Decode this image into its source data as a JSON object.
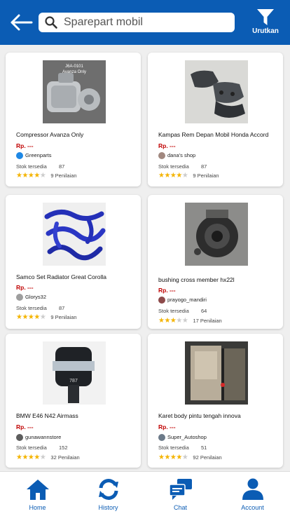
{
  "header": {
    "back_icon": "arrow-left-icon",
    "search_placeholder": "Sparepart mobil",
    "sort_label": "Urutkan",
    "colors": {
      "primary": "#0b5cb4",
      "price": "#c00000",
      "star": "#f4b400"
    }
  },
  "products": [
    {
      "name": "Compressor Avanza Only",
      "price": "Rp. ---",
      "seller": "Greenparts",
      "stock_label": "Stok tersedia",
      "stock": "87",
      "stars": 4,
      "reviews": "9 Penilaian",
      "image_caption": "J6A-0101\nAvanza Only"
    },
    {
      "name": "Kampas Rem Depan Mobil Honda Accord",
      "price": "Rp. ---",
      "seller": "dana's shop",
      "stock_label": "Stok tersedia",
      "stock": "87",
      "stars": 4,
      "reviews": "9 Penilaian"
    },
    {
      "name": "Samco Set Radiator Great Corolla",
      "price": "Rp. ---",
      "seller": "Glorys32",
      "stock_label": "Stok tersedia",
      "stock": "87",
      "stars": 4,
      "reviews": "9 Penilaian"
    },
    {
      "name": "bushing cross member hx22l",
      "price": "Rp. ---",
      "seller": "prayogo_mandiri",
      "stock_label": "Stok tersedia",
      "stock": "64",
      "stars": 3,
      "reviews": "17 Penilaian"
    },
    {
      "name": "BMW E46 N42 Airmass",
      "price": "Rp. ---",
      "seller": "gunawannstore",
      "stock_label": "Stok tersedia",
      "stock": "152",
      "stars": 4,
      "reviews": "32 Penilaian"
    },
    {
      "name": "Karet body pintu tengah innova",
      "price": "Rp. ---",
      "seller": "Super_Autoshop",
      "stock_label": "Stok tersedia",
      "stock": "51",
      "stars": 4,
      "reviews": "92 Penilaian"
    }
  ],
  "nav": {
    "home": "Home",
    "history": "History",
    "chat": "Chat",
    "account": "Account"
  }
}
